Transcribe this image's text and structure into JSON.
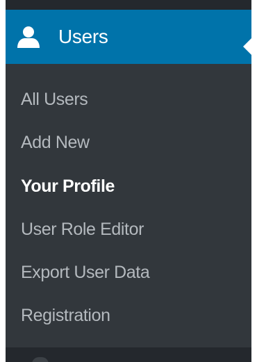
{
  "menu": {
    "title": "Users",
    "icon": "user-icon",
    "accent_color": "#0073aa",
    "background_color": "#32373c",
    "items": [
      {
        "label": "All Users",
        "current": false
      },
      {
        "label": "Add New",
        "current": false
      },
      {
        "label": "Your Profile",
        "current": true
      },
      {
        "label": "User Role Editor",
        "current": false
      },
      {
        "label": "Export User Data",
        "current": false
      },
      {
        "label": "Registration",
        "current": false
      }
    ]
  }
}
